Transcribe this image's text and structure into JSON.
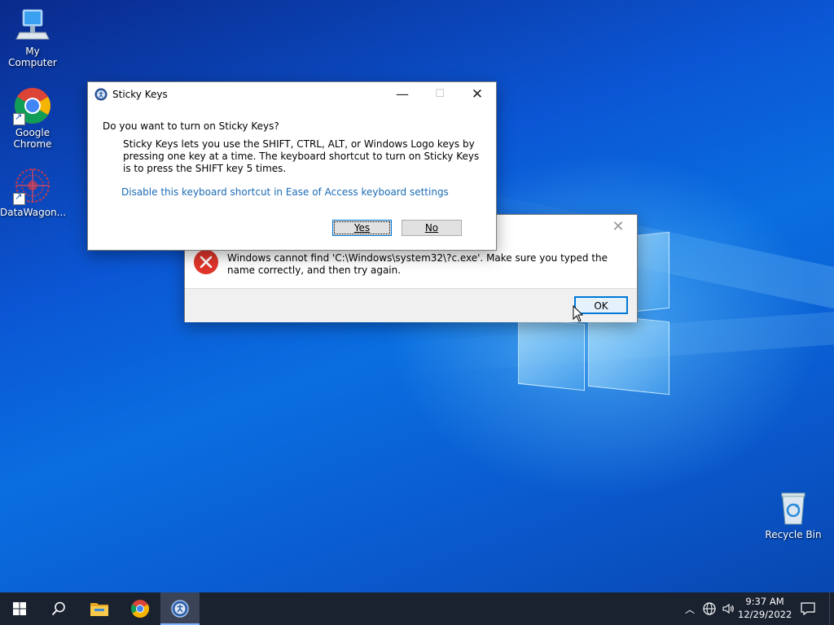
{
  "desktop": {
    "icons": [
      {
        "label": "My Computer",
        "icon": "computer-icon"
      },
      {
        "label": "Google Chrome",
        "icon": "chrome-icon"
      },
      {
        "label": "DataWagon...",
        "icon": "datawagon-icon"
      },
      {
        "label": "Recycle Bin",
        "icon": "recycle-bin-icon"
      }
    ]
  },
  "sticky_keys": {
    "title": "Sticky Keys",
    "question": "Do you want to turn on Sticky Keys?",
    "description": "Sticky Keys lets you use the SHIFT, CTRL, ALT, or Windows Logo keys by pressing one key at a time. The keyboard shortcut to turn on Sticky Keys is to press the SHIFT key 5 times.",
    "link": "Disable this keyboard shortcut in Ease of Access keyboard settings",
    "yes_label": "Yes",
    "no_label": "No"
  },
  "error_dialog": {
    "message": "Windows cannot find 'C:\\Windows\\system32\\?c.exe'. Make sure you typed the name correctly, and then try again.",
    "ok_label": "OK"
  },
  "taskbar": {
    "time": "9:37 AM",
    "date": "12/29/2022"
  },
  "colors": {
    "link": "#1a6bb5",
    "error_red": "#e0352b",
    "taskbar": "#1a2230",
    "active_indicator": "#7fb4ff"
  }
}
